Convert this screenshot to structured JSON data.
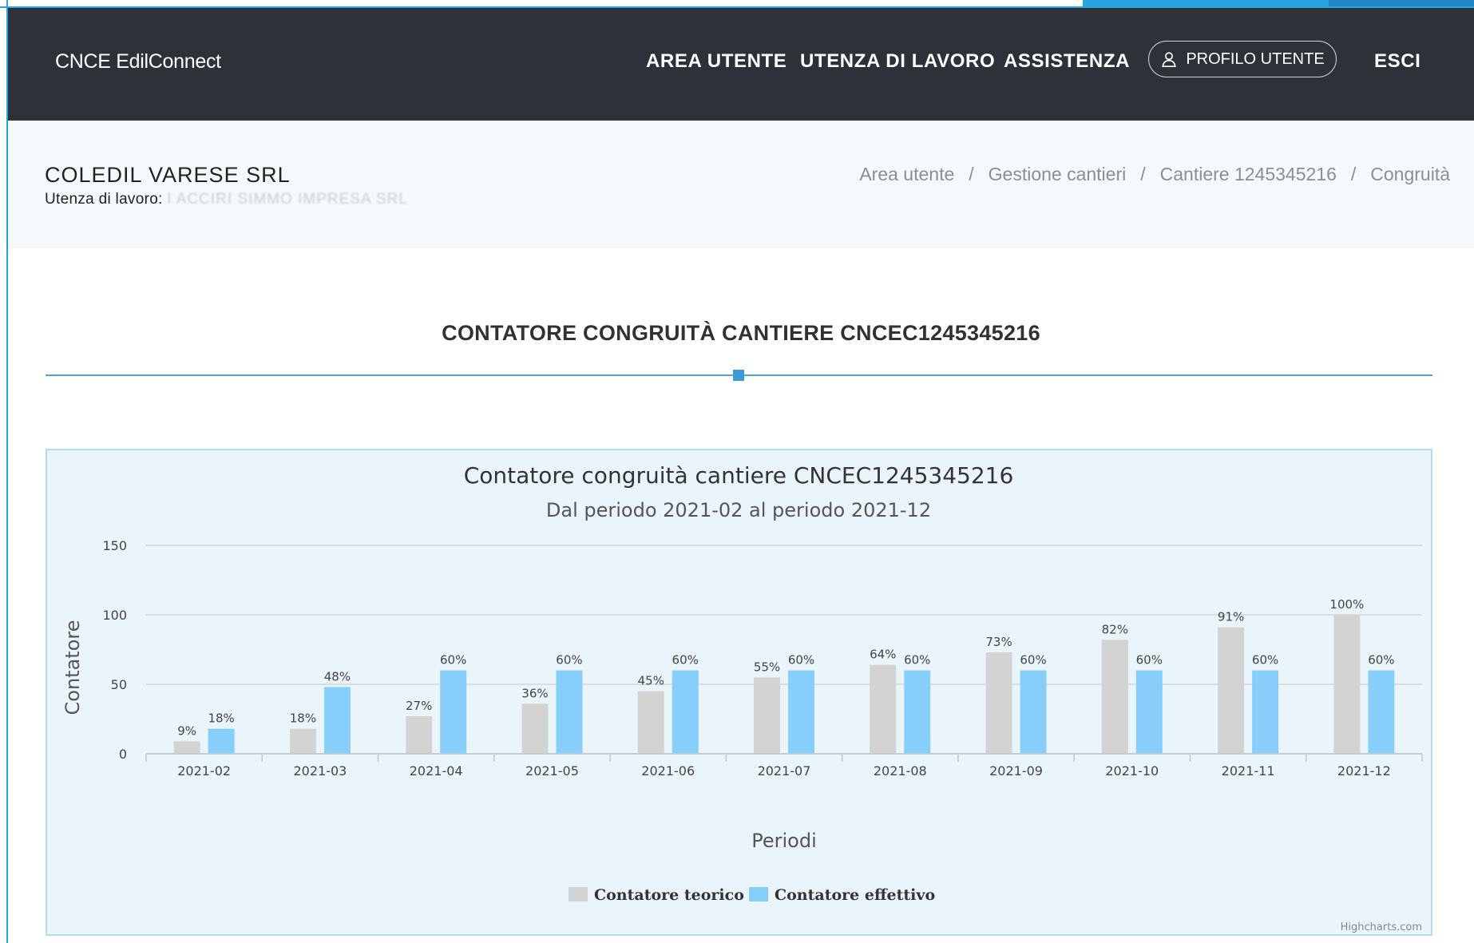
{
  "navbar": {
    "brand": "CNCE EdilConnect",
    "items": [
      "AREA UTENTE",
      "UTENZA DI LAVORO",
      "ASSISTENZA"
    ],
    "profile_label": "PROFILO UTENTE",
    "logout_label": "ESCI"
  },
  "subheader": {
    "company": "COLEDIL VARESE SRL",
    "utenza_label": "Utenza di lavoro:",
    "utenza_value": "I ACCIRI SIMMO IMPRESA SRL",
    "breadcrumb": [
      "Area utente",
      "Gestione cantieri",
      "Cantiere 1245345216",
      "Congruità"
    ]
  },
  "section": {
    "title": "CONTATORE CONGRUITÀ CANTIERE CNCEC1245345216"
  },
  "colors": {
    "navbar": "#2d3238",
    "accent": "#29a3e0",
    "teorico": "#d3d3d3",
    "effettivo": "#87cefa"
  },
  "chart_data": {
    "type": "bar",
    "title": "Contatore congruità cantiere CNCEC1245345216",
    "subtitle": "Dal periodo 2021-02 al periodo 2021-12",
    "xlabel": "Periodi",
    "ylabel": "Contatore",
    "ylim": [
      0,
      150
    ],
    "yticks": [
      0,
      50,
      100,
      150
    ],
    "grid": true,
    "legend_position": "bottom-center",
    "categories": [
      "2021-02",
      "2021-03",
      "2021-04",
      "2021-05",
      "2021-06",
      "2021-07",
      "2021-08",
      "2021-09",
      "2021-10",
      "2021-11",
      "2021-12"
    ],
    "series": [
      {
        "name": "Contatore teorico",
        "color": "#d3d3d3",
        "values": [
          9,
          18,
          27,
          36,
          45,
          55,
          64,
          73,
          82,
          91,
          100
        ],
        "labels": [
          "9%",
          "18%",
          "27%",
          "36%",
          "45%",
          "55%",
          "64%",
          "73%",
          "82%",
          "91%",
          "100%"
        ]
      },
      {
        "name": "Contatore effettivo",
        "color": "#87cefa",
        "values": [
          18,
          48,
          60,
          60,
          60,
          60,
          60,
          60,
          60,
          60,
          60
        ],
        "labels": [
          "18%",
          "48%",
          "60%",
          "60%",
          "60%",
          "60%",
          "60%",
          "60%",
          "60%",
          "60%",
          "60%"
        ]
      }
    ],
    "credits": "Highcharts.com"
  }
}
